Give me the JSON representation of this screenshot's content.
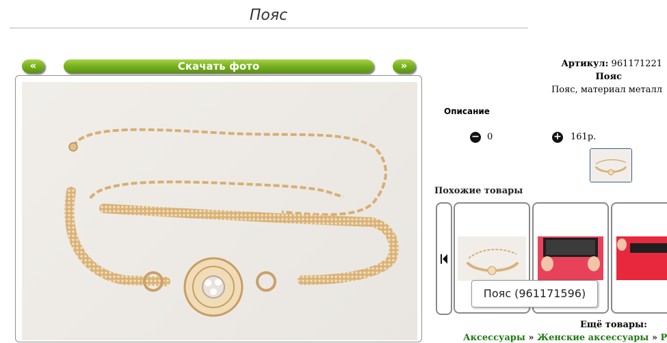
{
  "product": {
    "title": "Пояс",
    "article_label": "Артикул:",
    "article_value": "961171221",
    "name": "Пояс",
    "material": "Пояс, материал металл"
  },
  "photo_nav": {
    "prev_label": "«",
    "download_label": "Скачать фото",
    "next_label": "»"
  },
  "description": {
    "title": "Описание",
    "quantity": "0",
    "price": "161р."
  },
  "similar": {
    "title": "Похожие товары",
    "tooltip": "Пояс (961171596)"
  },
  "more": {
    "title": "Ещё товары:",
    "crumbs": [
      "Аксессуары",
      "Женские аксессуары",
      "Рем"
    ],
    "separator": "»"
  },
  "colors": {
    "accent_green": "#7ab320",
    "link_green": "#1f7a12"
  },
  "icons": {
    "minus": "minus-circle-icon",
    "plus": "plus-circle-icon",
    "prev": "skip-back-icon"
  }
}
